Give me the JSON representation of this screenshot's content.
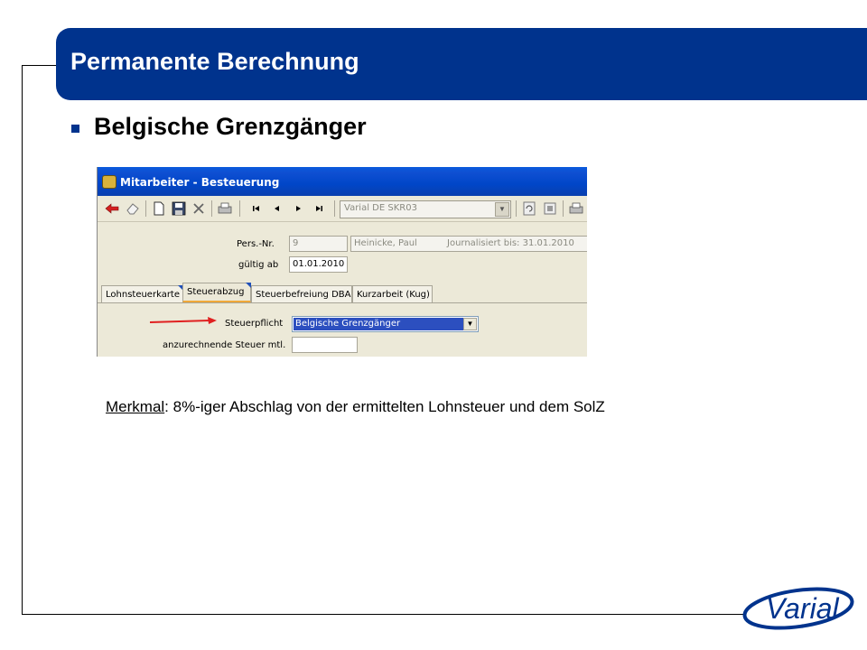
{
  "slide": {
    "title": "Permanente Berechnung",
    "subtitle": "Belgische Grenzgänger",
    "note_label": "Merkmal",
    "note_text": ": 8%-iger Abschlag von der ermittelten Lohnsteuer und dem SolZ",
    "logo_text": "Varial"
  },
  "window": {
    "title": "Mitarbeiter - Besteuerung",
    "toolbar": {
      "combo_value": "Varial  DE SKR03",
      "icons": [
        "back-arrow-icon",
        "eraser-icon",
        "new-document-icon",
        "save-icon",
        "delete-icon",
        "print-icon",
        "first-record-icon",
        "previous-record-icon",
        "next-record-icon",
        "last-record-icon",
        "refresh-icon",
        "settings-icon",
        "printer-icon"
      ]
    },
    "header": {
      "pers_nr_label": "Pers.-Nr.",
      "pers_nr_value": "9",
      "name_value": "Heinicke, Paul",
      "journal_value": "Journalisiert bis: 31.01.2010",
      "gueltig_label": "gültig ab",
      "gueltig_value": "01.01.2010"
    },
    "tabs": [
      {
        "label": "Lohnsteuerkarte"
      },
      {
        "label": "Steuerabzug"
      },
      {
        "label": "Steuerbefreiung DBA"
      },
      {
        "label": "Kurzarbeit (Kug)"
      }
    ],
    "form": {
      "steuerpflicht_label": "Steuerpflicht",
      "steuerpflicht_value": "Belgische Grenzgänger",
      "anzurechnende_label": "anzurechnende Steuer mtl.",
      "anzurechnende_value": ""
    }
  },
  "colors": {
    "title_bar": "#00338d",
    "arrow": "#e02020",
    "tab_highlight": "#f0a83a"
  }
}
